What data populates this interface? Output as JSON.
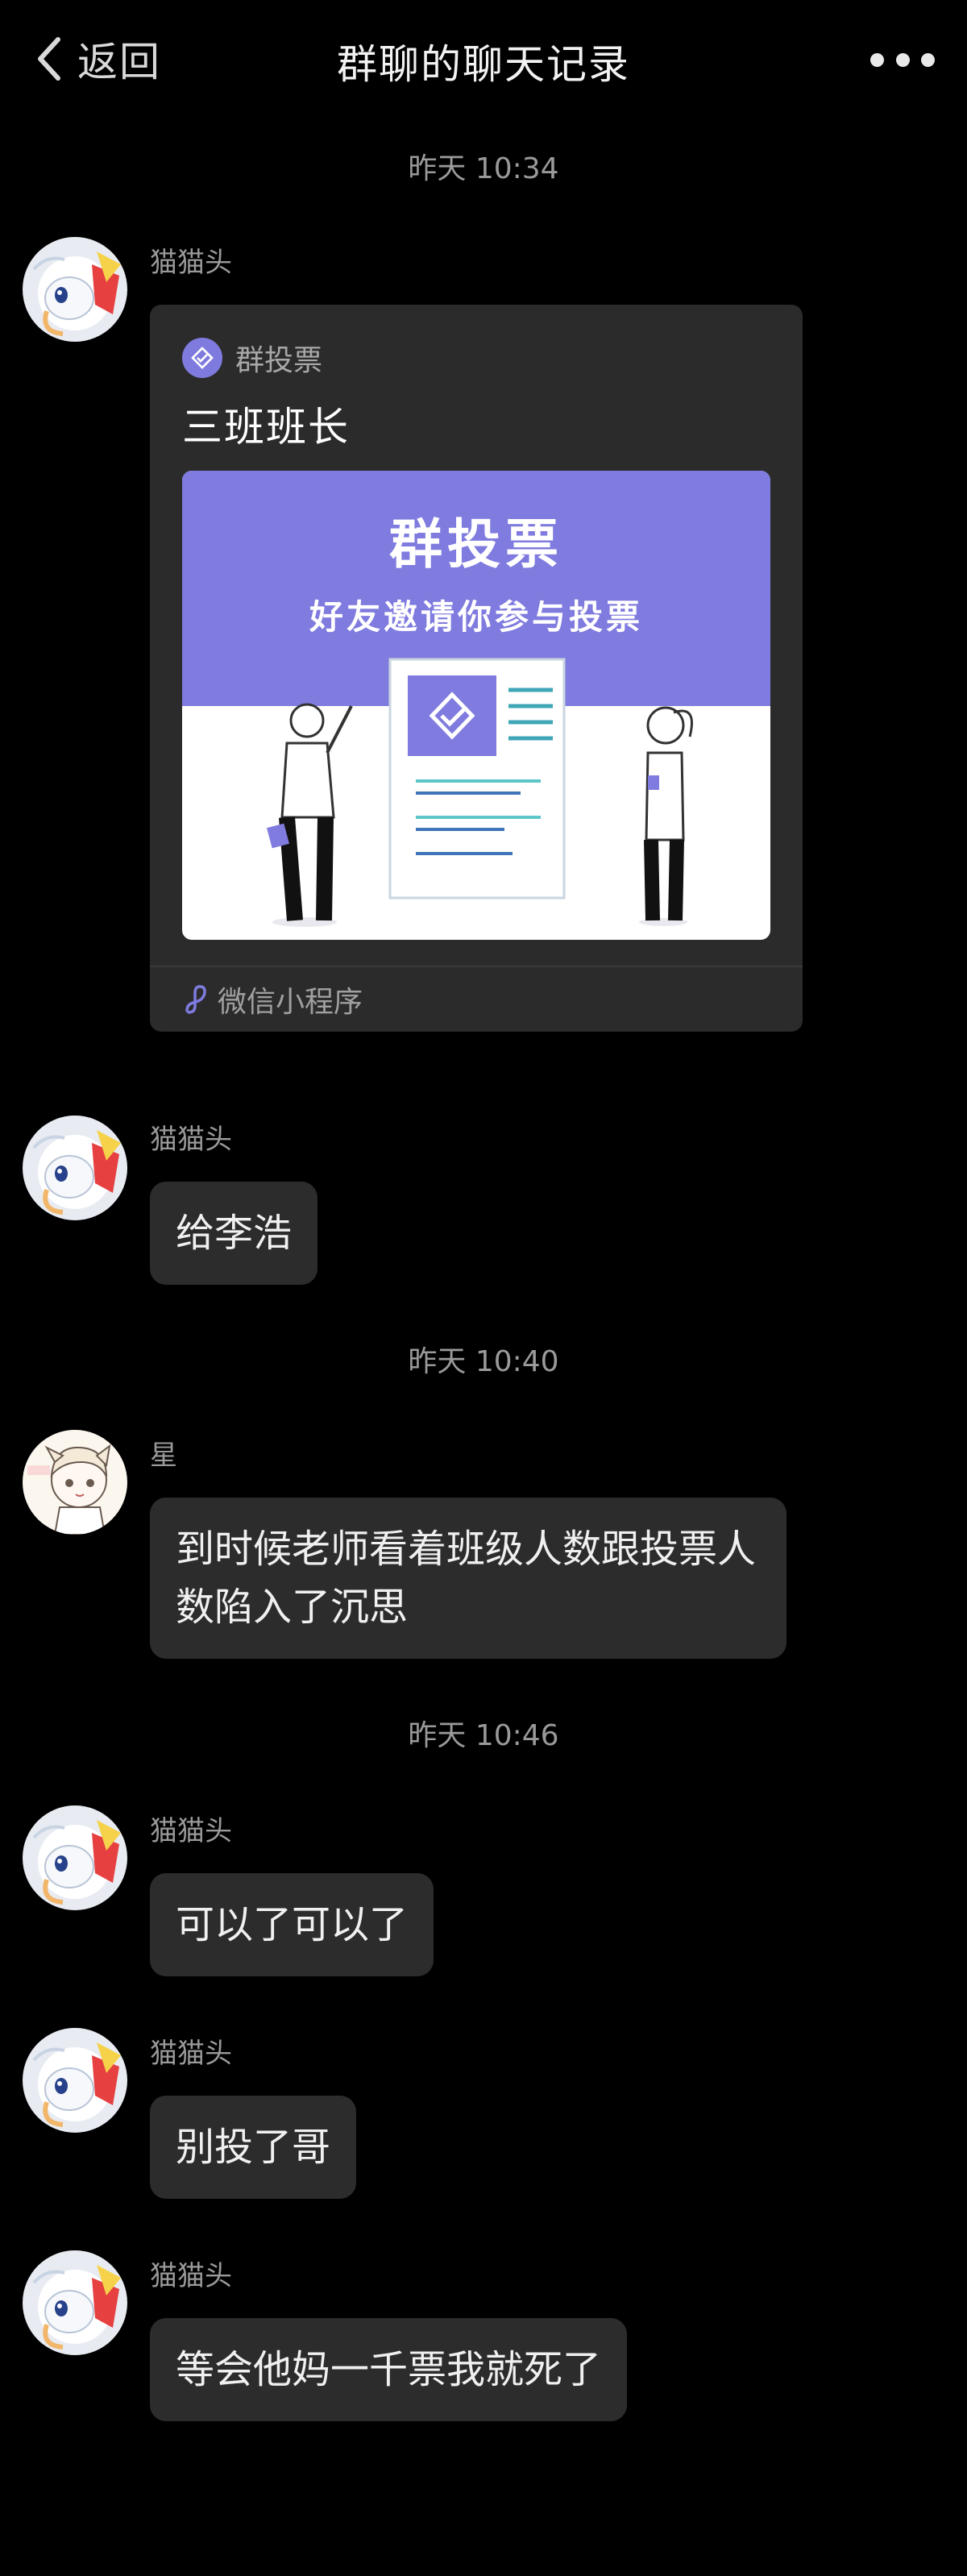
{
  "header": {
    "back_label": "返回",
    "title": "群聊的聊天记录",
    "back_icon": "chevron-left-icon",
    "more_icon": "more-dots-icon"
  },
  "times": [
    "昨天 10:34",
    "昨天 10:40",
    "昨天 10:46"
  ],
  "messages": [
    {
      "sender": "猫猫头",
      "avatar": "cat-avatar",
      "card": {
        "source_label": "群投票",
        "source_icon": "vote-icon",
        "title": "三班班长",
        "banner_title": "群投票",
        "banner_subtitle": "好友邀请你参与投票",
        "footer_label": "微信小程序",
        "footer_icon": "mini-program-icon",
        "accent_color": "#7f7bdf"
      }
    },
    {
      "sender": "猫猫头",
      "avatar": "cat-avatar",
      "text": "给李浩"
    },
    {
      "sender": "星",
      "avatar": "anime-avatar",
      "text": "到时候老师看着班级人数跟投票人数陷入了沉思"
    },
    {
      "sender": "猫猫头",
      "avatar": "cat-avatar",
      "text": "可以了可以了"
    },
    {
      "sender": "猫猫头",
      "avatar": "cat-avatar",
      "text": "别投了哥"
    },
    {
      "sender": "猫猫头",
      "avatar": "cat-avatar",
      "text": "等会他妈一千票我就死了"
    }
  ],
  "colors": {
    "background": "#000000",
    "bubble": "#2c2c2c",
    "secondary_text": "#9a9a9a",
    "accent": "#7f7bdf"
  }
}
